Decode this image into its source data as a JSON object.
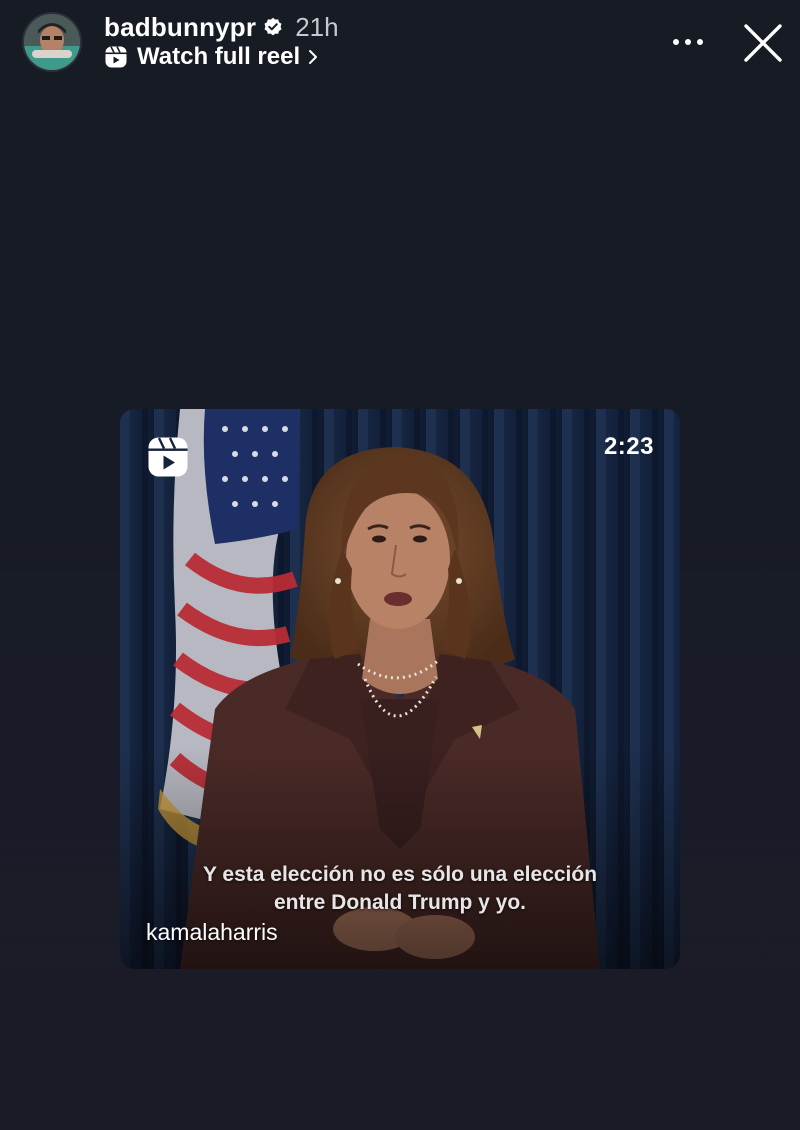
{
  "story": {
    "username": "badbunnypr",
    "timestamp": "21h",
    "verified": true,
    "reel_link_label": "Watch full reel",
    "avatar_icon": "profile-avatar",
    "more_icon": "more-horizontal-icon",
    "close_icon": "close-icon"
  },
  "reel": {
    "duration": "2:23",
    "subtitle_lines": [
      "Y esta elección no es sólo una elección",
      "entre Donald Trump y yo."
    ],
    "author": "kamalaharris",
    "reel_icon": "reels-icon"
  },
  "colors": {
    "background": "#171b25",
    "text": "#ffffff",
    "muted_text": "#c6c9cf",
    "curtain": "#16233c",
    "suit": "#4a2a27"
  }
}
